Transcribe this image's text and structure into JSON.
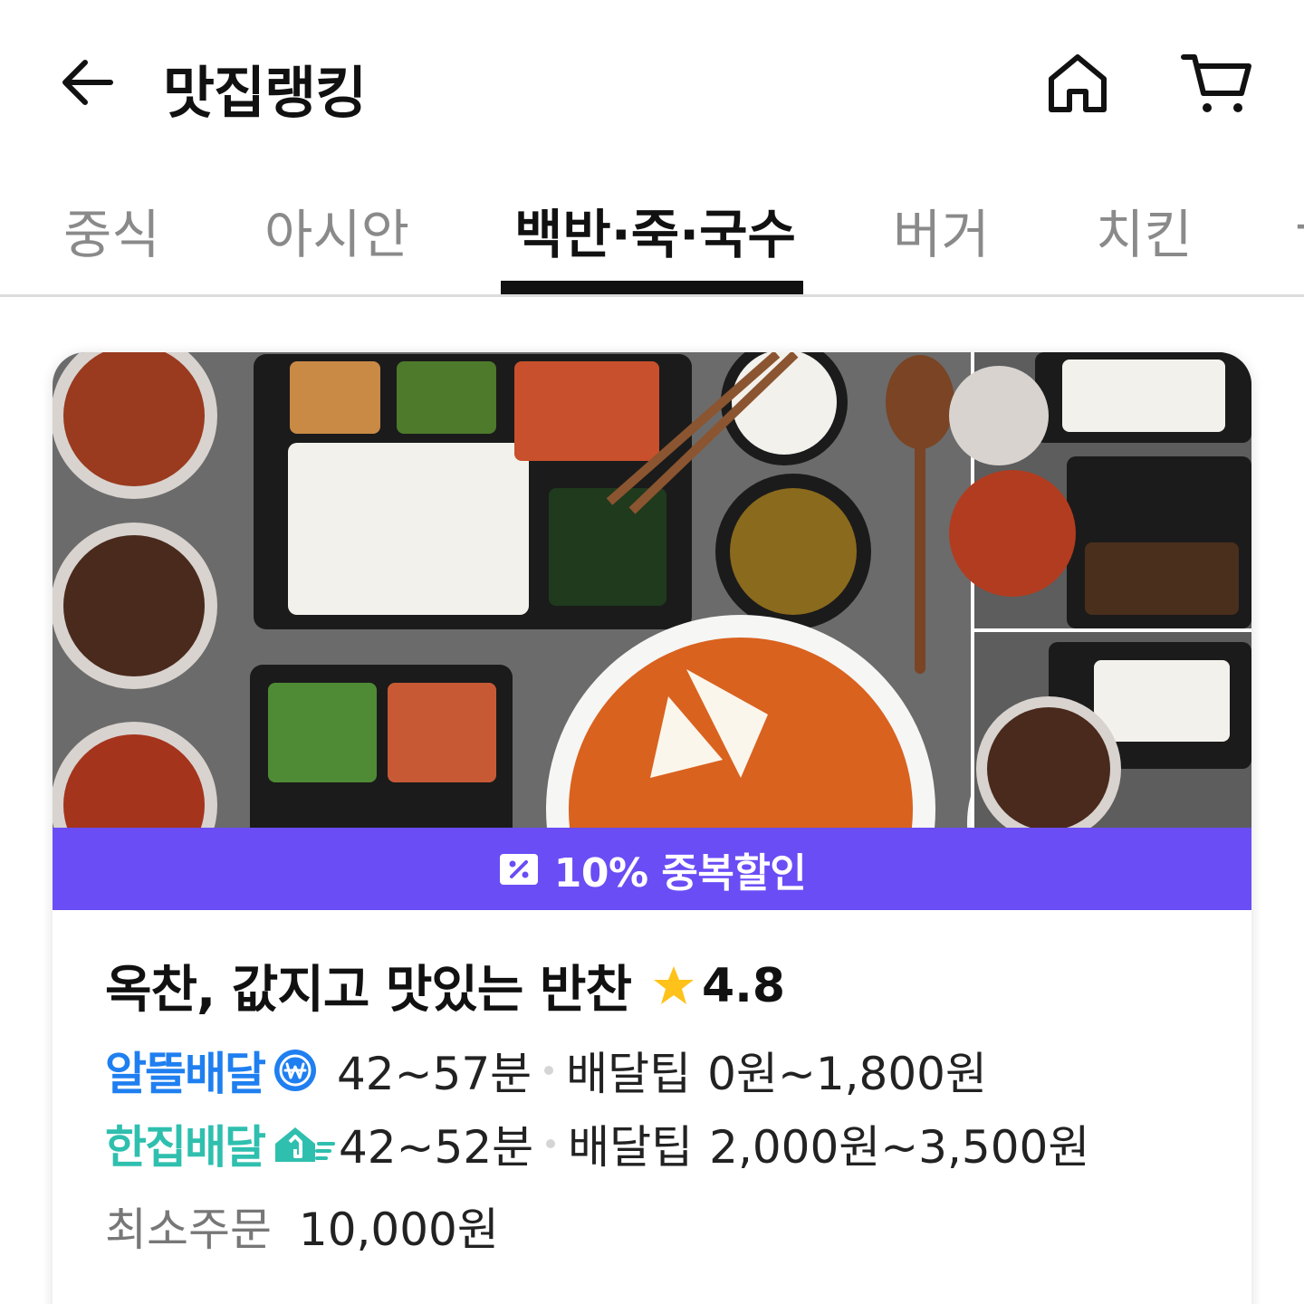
{
  "header": {
    "title": "맛집랭킹",
    "back_icon": "arrow-left-icon",
    "home_icon": "home-icon",
    "cart_icon": "cart-icon"
  },
  "tabs": [
    {
      "label": "중식",
      "active": false
    },
    {
      "label": "아시안",
      "active": false
    },
    {
      "label": "백반·죽·국수",
      "active": true
    },
    {
      "label": "버거",
      "active": false
    },
    {
      "label": "치킨",
      "active": false
    },
    {
      "label": "-",
      "active": false
    }
  ],
  "card": {
    "promo": {
      "text": "10% 중복할인",
      "color": "#6a4df5",
      "icon": "discount-coupon-icon"
    },
    "store": {
      "name": "옥찬, 값지고 맛있는 반찬",
      "rating": "4.8",
      "star_color": "#ffc21a"
    },
    "delivery": [
      {
        "brand": "알뜰배달",
        "brand_color": "#1f7ff0",
        "icon": "won-coin-icon",
        "time": "42~57분",
        "tip_label": "배달팁",
        "tip": "0원~1,800원"
      },
      {
        "brand": "한집배달",
        "brand_color": "#2fbfae",
        "icon": "fast-home-icon",
        "time": "42~52분",
        "tip_label": "배달팁",
        "tip": "2,000원~3,500원"
      }
    ],
    "min_order": {
      "label": "최소주문",
      "value": "10,000원"
    }
  }
}
